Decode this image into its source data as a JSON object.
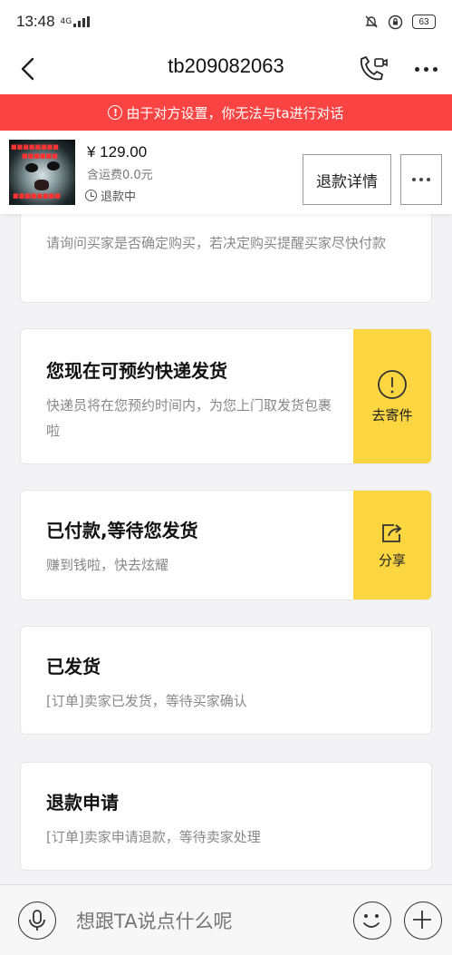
{
  "status_bar": {
    "time": "13:48",
    "network": "4G",
    "battery": "63"
  },
  "nav": {
    "title": "tb209082063"
  },
  "alert": {
    "text": "由于对方设置，你无法与ta进行对话",
    "color": "#f94443"
  },
  "product": {
    "price": "¥ 129.00",
    "shipping": "含运费0.0元",
    "status": "退款中",
    "refund_button": "退款详情"
  },
  "cards": [
    {
      "title": "",
      "desc": "请询问买家是否确定购买，若决定购买提醒买家尽快付款"
    },
    {
      "title": "您现在可预约快递发货",
      "desc": "快递员将在您预约时间内，为您上门取发货包裹啦",
      "action_label": "去寄件",
      "action_icon": "info-circle-icon"
    },
    {
      "title": "已付款,等待您发货",
      "desc": "赚到钱啦，快去炫耀",
      "action_label": "分享",
      "action_icon": "share-icon"
    },
    {
      "title": "已发货",
      "desc": "[订单]卖家已发货，等待买家确认"
    },
    {
      "title": "退款申请",
      "desc": "[订单]卖家申请退款，等待卖家处理"
    }
  ],
  "input_bar": {
    "placeholder": "想跟TA说点什么呢"
  },
  "colors": {
    "action_yellow": "#fbd640",
    "alert_red": "#f94443"
  }
}
